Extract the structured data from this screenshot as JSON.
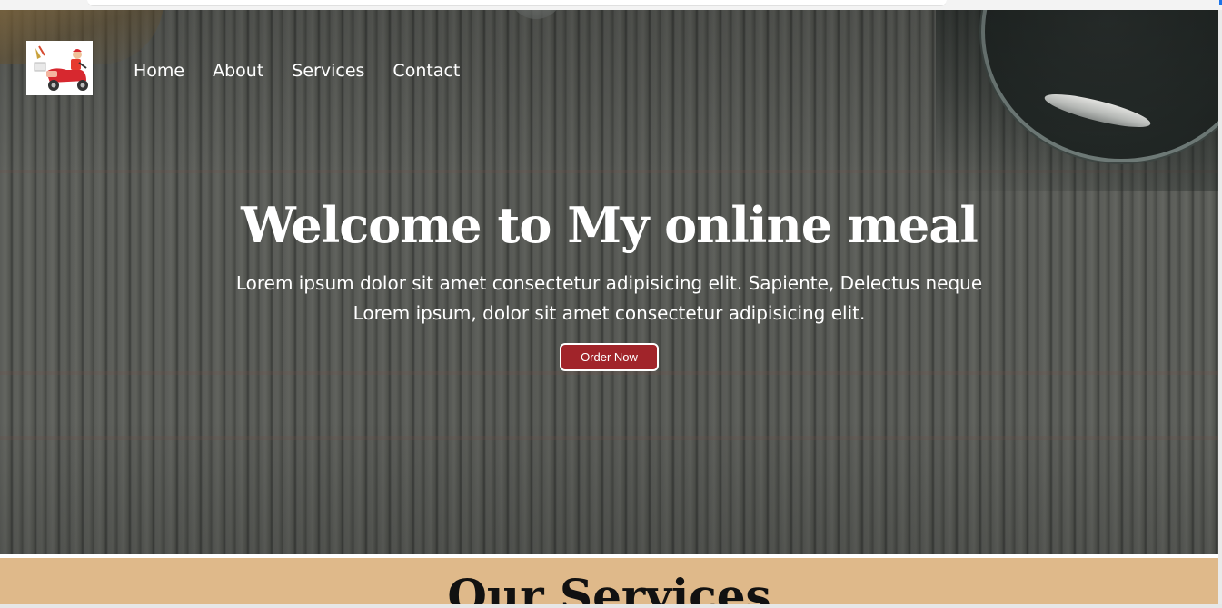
{
  "nav": {
    "logo_alt": "delivery scooter logo",
    "items": [
      {
        "label": "Home"
      },
      {
        "label": "About"
      },
      {
        "label": "Services"
      },
      {
        "label": "Contact"
      }
    ]
  },
  "hero": {
    "title": "Welcome to My online meal",
    "text_line1": "Lorem ipsum dolor sit amet consectetur adipisicing elit. Sapiente, Delectus neque",
    "text_line2": "Lorem ipsum, dolor sit amet consectetur adipisicing elit.",
    "button_label": "Order Now"
  },
  "services": {
    "title": "Our Services"
  },
  "colors": {
    "button_bg": "#a1242a",
    "services_bg": "#dfb98a",
    "hero_overlay": "#4b4d4a"
  }
}
